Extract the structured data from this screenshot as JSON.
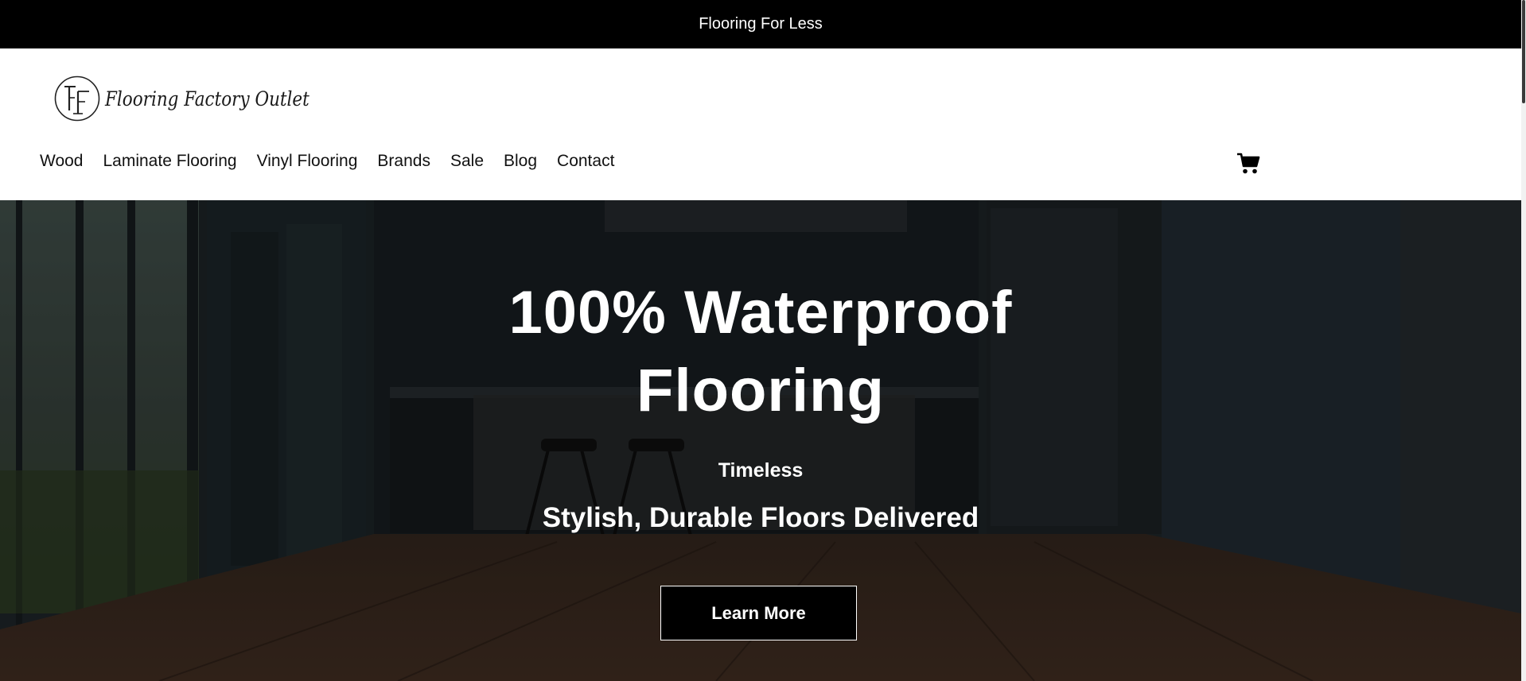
{
  "announcement": {
    "text": "Flooring For Less"
  },
  "header": {
    "logo_text": "Flooring Factory Outlet",
    "nav": [
      {
        "label": "Wood"
      },
      {
        "label": "Laminate Flooring"
      },
      {
        "label": "Vinyl Flooring"
      },
      {
        "label": "Brands"
      },
      {
        "label": "Sale"
      },
      {
        "label": "Blog"
      },
      {
        "label": "Contact"
      }
    ],
    "cart_icon": "cart-icon"
  },
  "hero": {
    "title_line1": "100% Waterproof",
    "title_line2": "Flooring",
    "eyebrow": "Timeless",
    "subtitle": "Stylish, Durable Floors Delivered",
    "button_label": "Learn More"
  },
  "colors": {
    "announcement_bg": "#000000",
    "header_bg": "#ffffff",
    "hero_text": "#ffffff",
    "button_bg": "#000000"
  }
}
